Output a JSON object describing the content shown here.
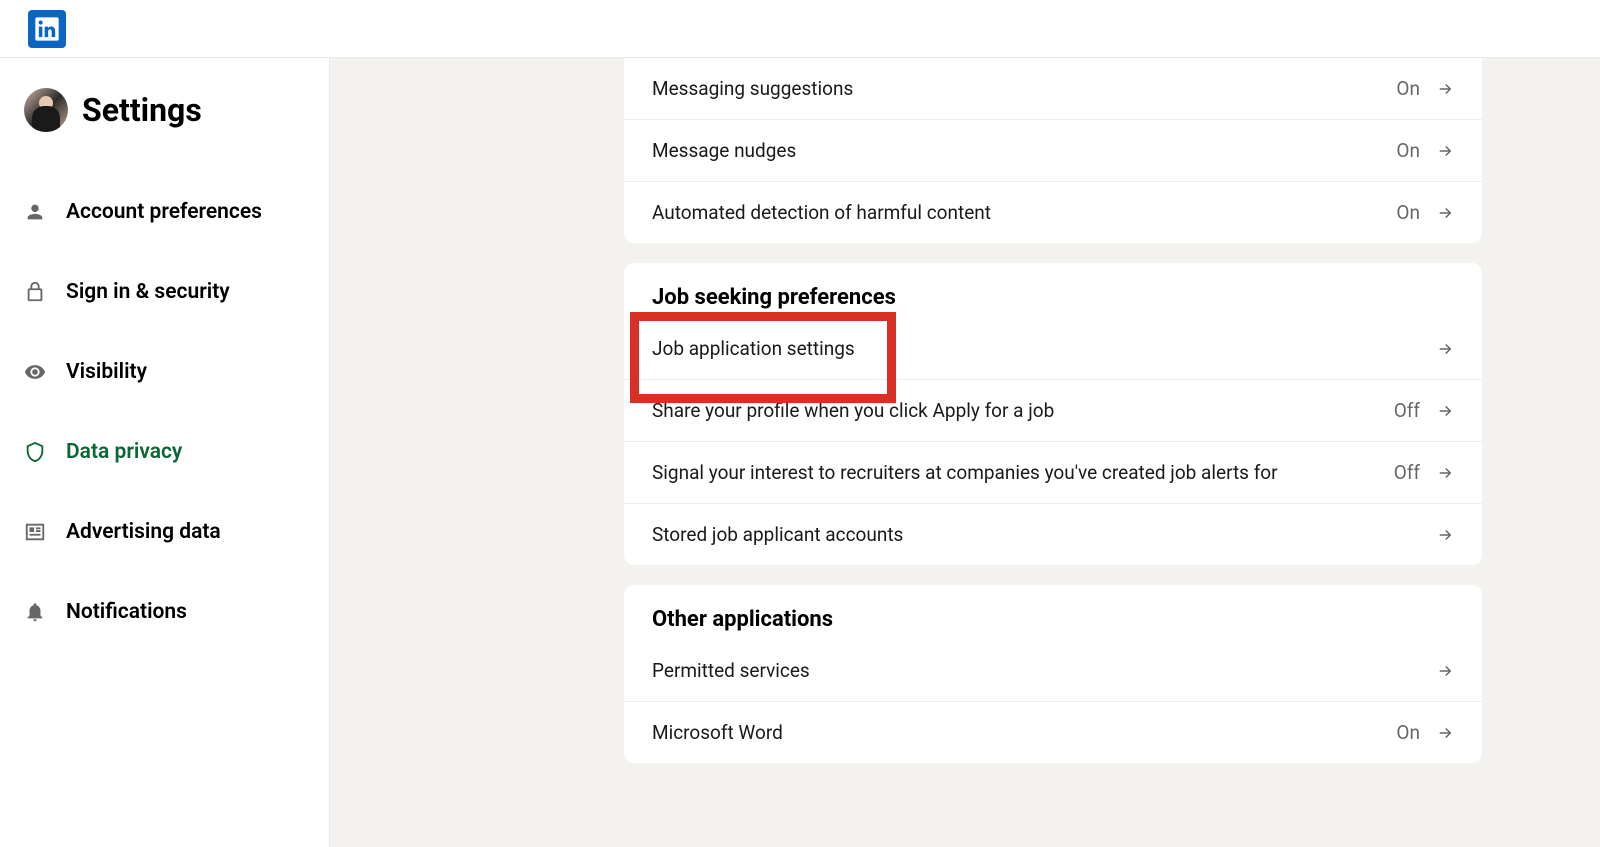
{
  "title": "Settings",
  "nav": {
    "account": "Account preferences",
    "security": "Sign in & security",
    "visibility": "Visibility",
    "privacy": "Data privacy",
    "advertising": "Advertising data",
    "notifications": "Notifications"
  },
  "sections": {
    "messaging": {
      "rows": {
        "suggestions": {
          "label": "Messaging suggestions",
          "value": "On"
        },
        "nudges": {
          "label": "Message nudges",
          "value": "On"
        },
        "harmful": {
          "label": "Automated detection of harmful content",
          "value": "On"
        }
      }
    },
    "jobseeking": {
      "title": "Job seeking preferences",
      "rows": {
        "application": {
          "label": "Job application settings",
          "value": ""
        },
        "share": {
          "label": "Share your profile when you click Apply for a job",
          "value": "Off"
        },
        "signal": {
          "label": "Signal your interest to recruiters at companies you've created job alerts for",
          "value": "Off"
        },
        "stored": {
          "label": "Stored job applicant accounts",
          "value": ""
        }
      }
    },
    "other": {
      "title": "Other applications",
      "rows": {
        "permitted": {
          "label": "Permitted services",
          "value": ""
        },
        "word": {
          "label": "Microsoft Word",
          "value": "On"
        }
      }
    }
  }
}
